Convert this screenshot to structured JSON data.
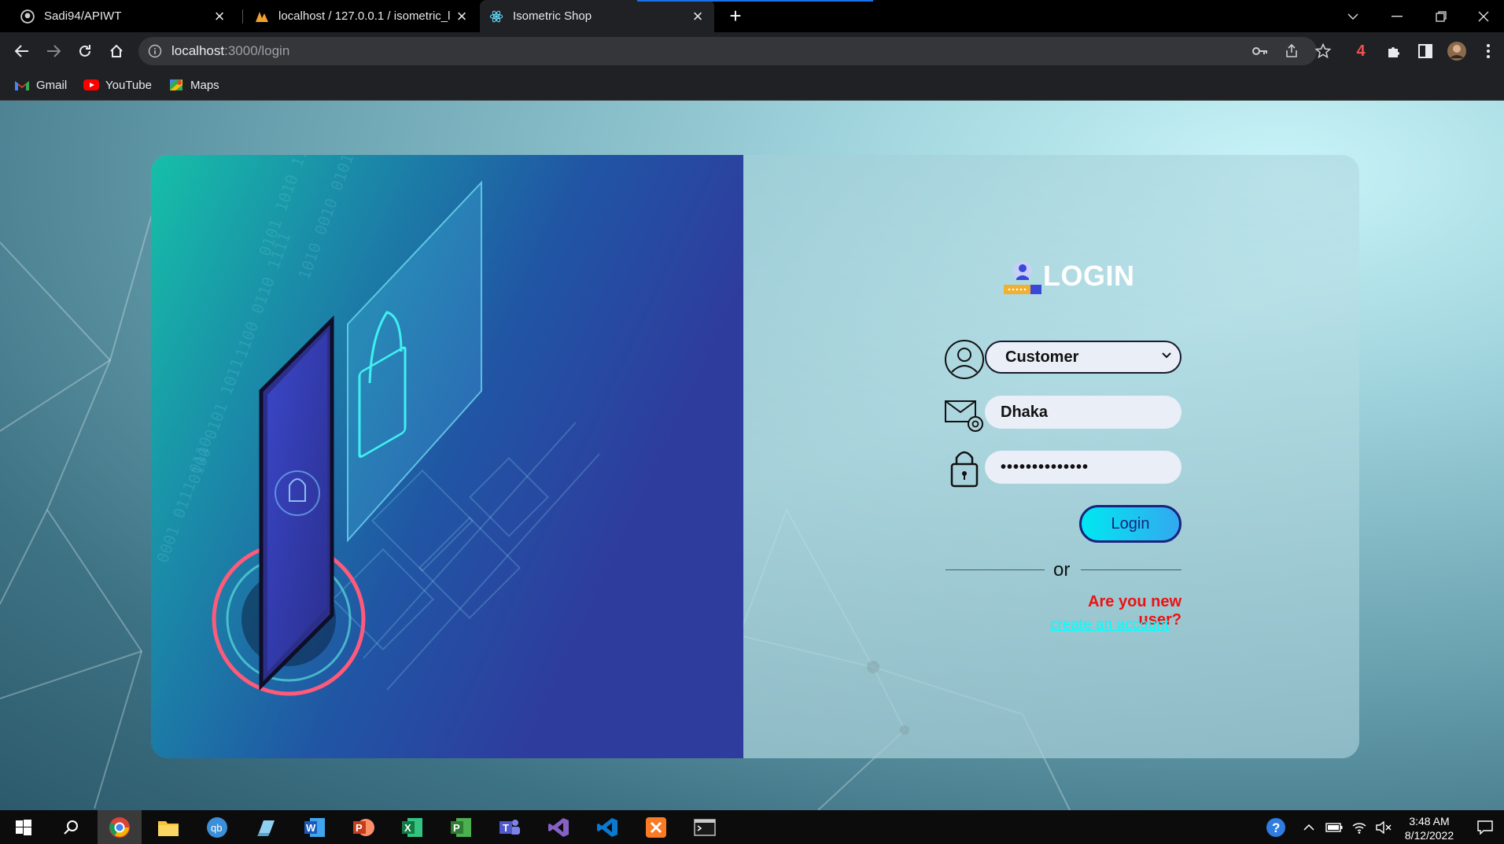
{
  "browser": {
    "tabs": [
      {
        "title": "Sadi94/APIWT",
        "icon": "github-icon"
      },
      {
        "title": "localhost / 127.0.0.1 / isometric_l",
        "icon": "phpmyadmin-icon"
      },
      {
        "title": "Isometric Shop",
        "icon": "react-icon",
        "active": true
      }
    ],
    "url_host": "localhost",
    "url_path": ":3000/login",
    "bookmarks": [
      {
        "label": "Gmail",
        "icon": "gmail-icon"
      },
      {
        "label": "YouTube",
        "icon": "youtube-icon"
      },
      {
        "label": "Maps",
        "icon": "maps-icon"
      }
    ],
    "extension_badge": "4"
  },
  "login": {
    "title": "LOGIN",
    "role_select_value": "Customer",
    "username_value": "Dhaka",
    "password_value": "••••••••••••••",
    "login_button": "Login",
    "divider_text": "or",
    "new_user_text": "Are you new user?",
    "create_account_link": "create an account"
  },
  "taskbar": {
    "time": "3:48 AM",
    "date": "8/12/2022"
  },
  "colors": {
    "accent_cyan": "#00ffff",
    "warning_red": "#ee1111",
    "button_border": "#1a237e"
  }
}
